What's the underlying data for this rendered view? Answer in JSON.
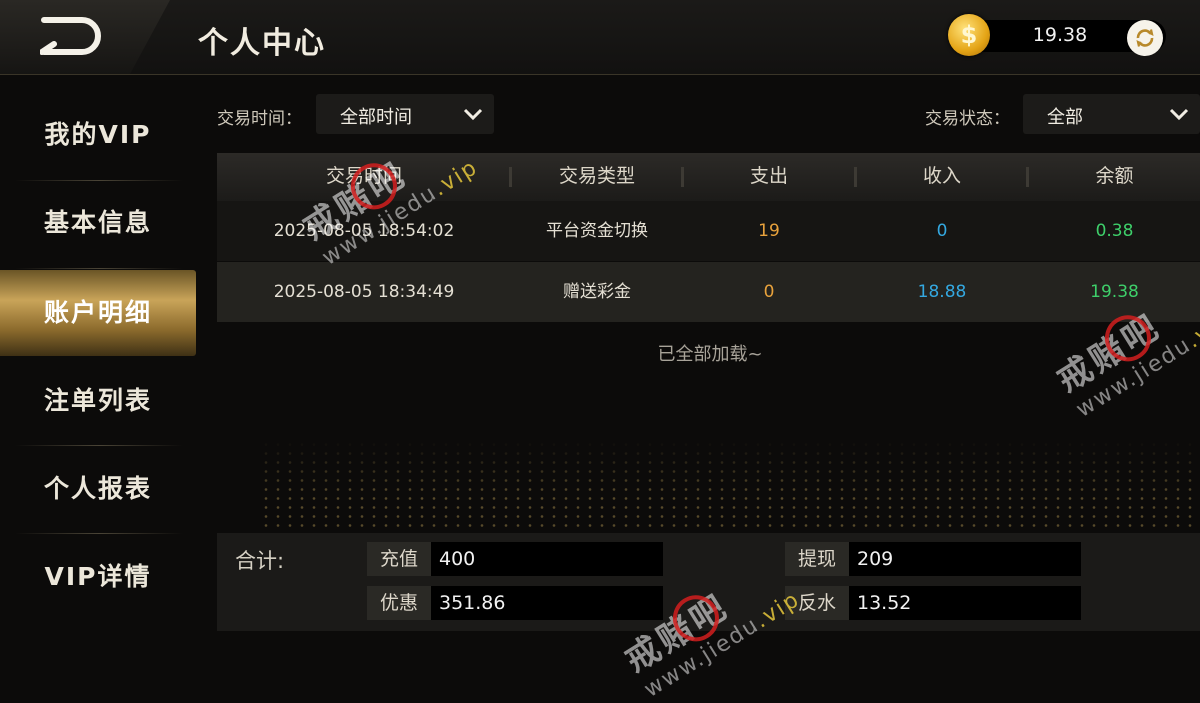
{
  "header": {
    "title": "个人中心",
    "balance": "19.38",
    "coin_symbol": "$"
  },
  "sidebar": {
    "items": [
      {
        "label": "我的VIP"
      },
      {
        "label": "基本信息"
      },
      {
        "label": "账户明细",
        "active": true
      },
      {
        "label": "注单列表"
      },
      {
        "label": "个人报表"
      },
      {
        "label": "VIP详情"
      }
    ]
  },
  "filters": {
    "time_label": "交易时间：",
    "time_value": "全部时间",
    "status_label": "交易状态：",
    "status_value": "全部"
  },
  "table": {
    "headers": [
      "交易时间",
      "交易类型",
      "支出",
      "收入",
      "余额"
    ],
    "rows": [
      {
        "time": "2025-08-05 18:54:02",
        "type": "平台资金切换",
        "out": "19",
        "in": "0",
        "balance": "0.38"
      },
      {
        "time": "2025-08-05 18:34:49",
        "type": "赠送彩金",
        "out": "0",
        "in": "18.88",
        "balance": "19.38"
      }
    ],
    "footer": "已全部加载~"
  },
  "summary": {
    "label": "合计:",
    "recharge_label": "充值",
    "recharge_value": "400",
    "withdraw_label": "提现",
    "withdraw_value": "209",
    "discount_label": "优惠",
    "discount_value": "351.86",
    "rebate_label": "反水",
    "rebate_value": "13.52"
  },
  "watermark": {
    "text": "戒赌吧",
    "url_prefix": "www.jiedu",
    "url_suffix": ".vip"
  },
  "colors": {
    "gold": "#c9a459",
    "out": "#e8a23c",
    "in": "#34a8e0",
    "balance": "#3ecf6a"
  }
}
